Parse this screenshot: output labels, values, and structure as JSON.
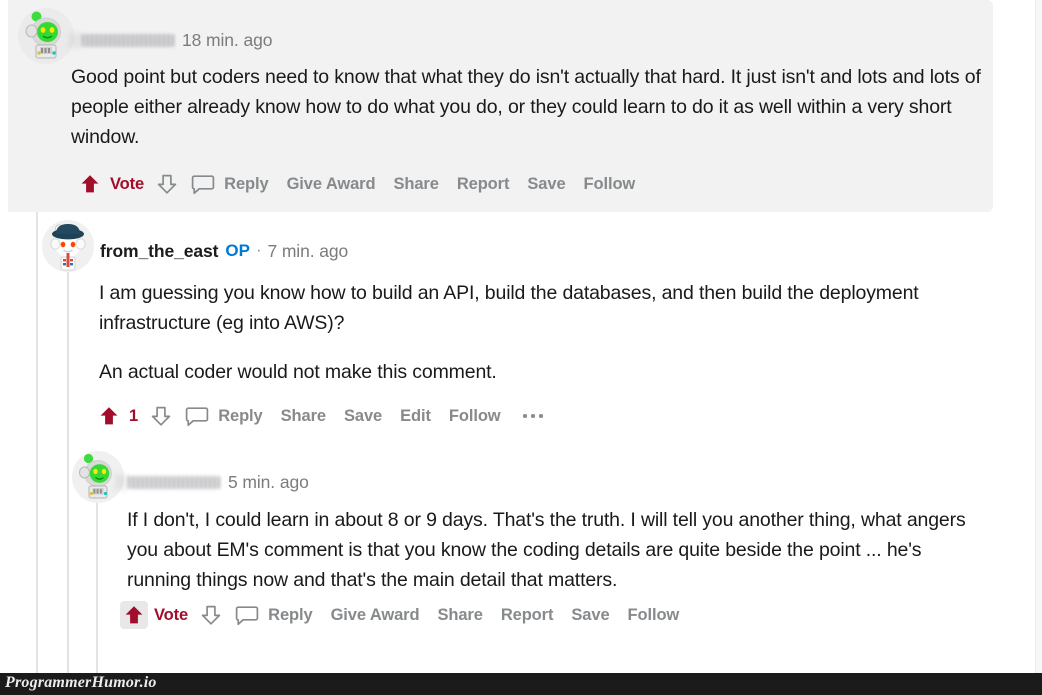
{
  "site": {
    "watermark": "ProgrammerHumor.io",
    "accent_upvote": "#a10e2b",
    "accent_op": "#0079d3",
    "action_text_color": "#878a8c",
    "highlight_bg": "#f2f2f2"
  },
  "comments": [
    {
      "id": "comment-1",
      "username": "",
      "username_redacted": true,
      "timestamp": "18 min. ago",
      "avatar": "snoo-astronaut-green-icon",
      "highlighted": true,
      "paragraphs": [
        "Good point but coders need to know that what they do isn't actually that hard. It just isn't and lots and lots of people either already know how to do what you do, or they could learn to do it as well within a very short window."
      ],
      "vote_label": "Vote",
      "actions": [
        "Reply",
        "Give Award",
        "Share",
        "Report",
        "Save",
        "Follow"
      ]
    },
    {
      "id": "comment-2",
      "username": "from_the_east",
      "username_redacted": false,
      "op_badge": "OP",
      "separator": "·",
      "timestamp": "7 min. ago",
      "avatar": "snoo-hat-navy-icon",
      "highlighted": false,
      "paragraphs": [
        "I am guessing you know how to build an API, build the databases, and then build the deployment infrastructure (eg into AWS)?",
        "An actual coder would not make this comment."
      ],
      "score": "1",
      "actions": [
        "Reply",
        "Share",
        "Save",
        "Edit",
        "Follow"
      ],
      "has_overflow_menu": true
    },
    {
      "id": "comment-3",
      "username": "",
      "username_redacted": true,
      "timestamp": "5 min. ago",
      "avatar": "snoo-astronaut-green-icon",
      "highlighted": false,
      "upvote_hovered": true,
      "paragraphs": [
        "If I don't, I could learn in about 8 or 9 days. That's the truth. I will tell you another thing, what angers you about EM's comment is that you know the coding details are quite beside the point ... he's running things now and that's the main detail that matters."
      ],
      "vote_label": "Vote",
      "actions": [
        "Reply",
        "Give Award",
        "Share",
        "Report",
        "Save",
        "Follow"
      ]
    }
  ]
}
